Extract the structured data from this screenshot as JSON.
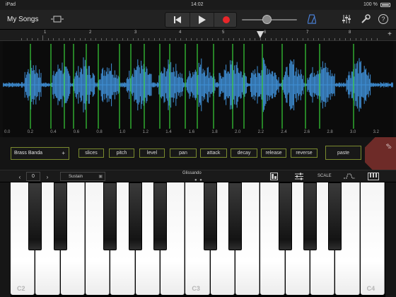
{
  "status": {
    "device": "iPad",
    "time": "14:02",
    "battery": "100 %"
  },
  "topbar": {
    "title": "My Songs",
    "icons": [
      "browser-icon",
      "rewind-icon",
      "play-icon",
      "record-icon",
      "metronome-icon",
      "mixer-icon",
      "wrench-icon",
      "help-icon"
    ],
    "help_label": "?",
    "record_color": "#e8262a",
    "volume_level": 0.45
  },
  "ruler": {
    "marks": [
      "1",
      "2",
      "3",
      "4",
      "5",
      "6",
      "7",
      "8"
    ]
  },
  "waveform": {
    "color": "#3f8fd6",
    "slice_color": "#3ad13a",
    "slice_count": 21,
    "axis_labels": [
      "0.0",
      "0.2",
      "0.4",
      "0.6",
      "0.8",
      "1.0",
      "1.2",
      "1.4",
      "1.6",
      "1.8",
      "2.0",
      "2.2",
      "2.4",
      "2.6",
      "2.8",
      "3.0",
      "3.2"
    ]
  },
  "params": {
    "preset": "Brass Banda",
    "preset_add": "+",
    "buttons": [
      "slices",
      "pitch",
      "level",
      "pan",
      "attack",
      "decay",
      "release",
      "reverse"
    ],
    "paste": "paste",
    "corner": "arp",
    "accent": "#7a8a2e"
  },
  "keyboard_bar": {
    "octave_prev": "‹",
    "octave_next": "›",
    "octave": "0",
    "sustain": "Sustain",
    "mode": "Glissando",
    "scale": "SCALE"
  },
  "keyboard": {
    "labels": {
      "c2": "C2",
      "c3": "C3",
      "c4": "C4"
    }
  }
}
